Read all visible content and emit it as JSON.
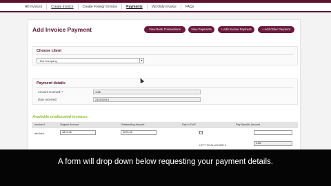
{
  "nav": {
    "items": [
      {
        "label": "All Invoices"
      },
      {
        "label": "Create Invoice"
      },
      {
        "label": "Create Foreign Invoice"
      },
      {
        "label": "Payments"
      },
      {
        "label": "Vat Only Invoice"
      },
      {
        "label": "FAQs"
      }
    ]
  },
  "page": {
    "title": "Add Invoice Payment",
    "buttons": {
      "view_bank": "View Bank Transactions",
      "view_payments": "View Payments",
      "add_invoice_payment": "+ Add Invoice Payment",
      "add_other_payment": "+ Add Other Payment"
    }
  },
  "client": {
    "section_title": "Choose client",
    "selected": "Test Company"
  },
  "payment": {
    "section_title": "Payment details",
    "amount_label": "Amount received: *",
    "amount_value": "4.88",
    "date_label": "Date received:",
    "date_value": "21/02/2013"
  },
  "unpaid": {
    "title": "Available unallocated invoices",
    "headers": [
      "Invoice #",
      "Original Amount",
      "Outstanding Amount",
      "Pay in Full?",
      "Pay Specific Amount"
    ],
    "rows": [
      {
        "invoice": "abc1abc",
        "original": "4876.28",
        "outstanding": "4876.28",
        "pay_specific": ""
      }
    ],
    "left_label": "LEFT TO ALLOCATE £",
    "left_value": "4.88"
  },
  "caption": "A form will drop down below requesting your payment details."
}
